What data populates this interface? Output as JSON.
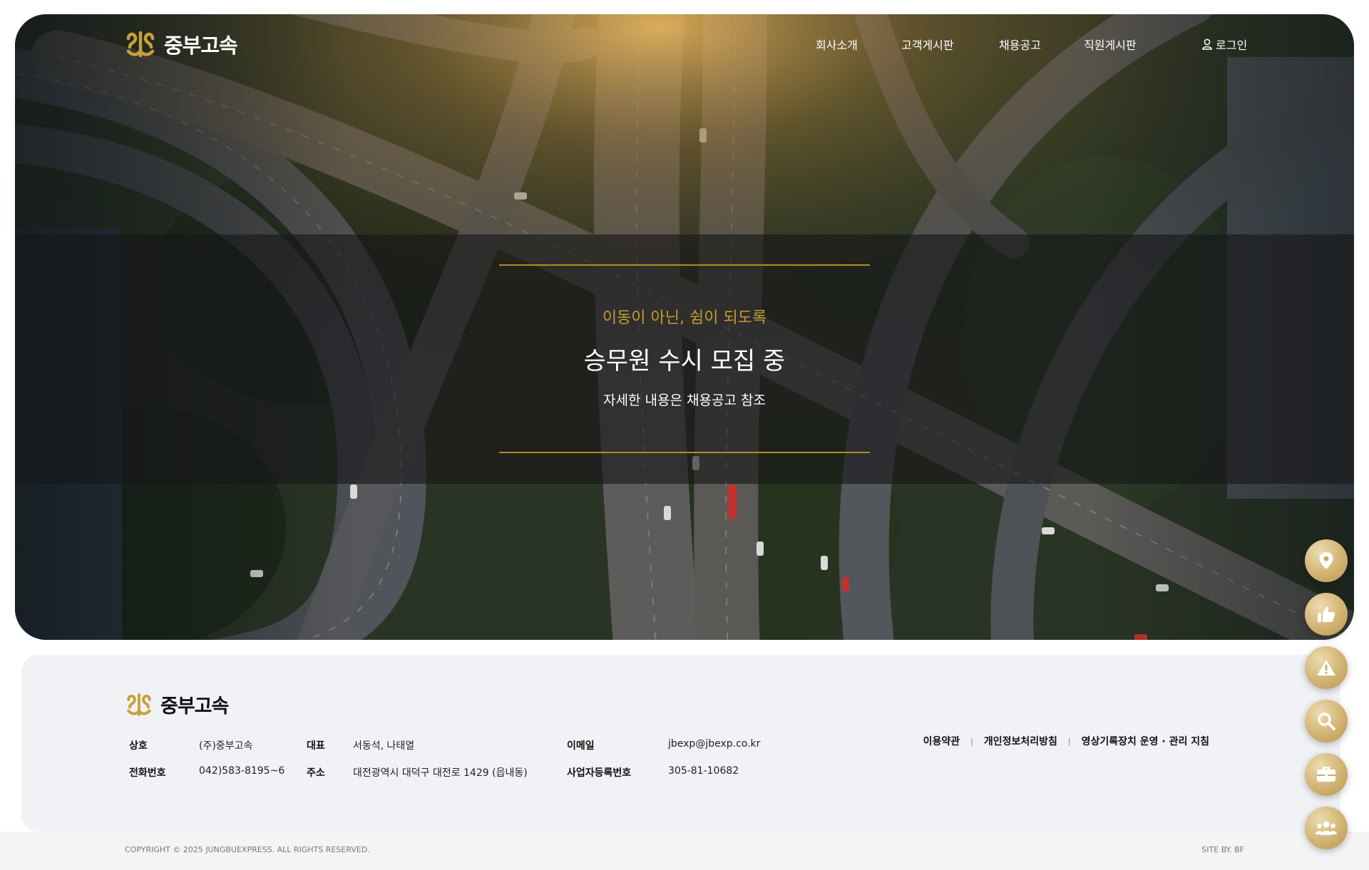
{
  "brand": {
    "name": "중부고속",
    "accent": "#b58a25",
    "logo_icon": "jungbu-emblem"
  },
  "nav": {
    "items": [
      {
        "label": "회사소개"
      },
      {
        "label": "고객게시판"
      },
      {
        "label": "채용공고"
      },
      {
        "label": "직원게시판"
      }
    ],
    "login_label": "로그인",
    "login_icon": "user-icon"
  },
  "hero": {
    "subtitle": "이동이 아닌, 쉼이 되도록",
    "title": "승무원 수시 모집 중",
    "description": "자세한 내용은 채용공고 참조"
  },
  "footer": {
    "info": {
      "company_label": "상호",
      "company": "(주)중부고속",
      "ceo_label": "대표",
      "ceo": "서동석, 나태열",
      "email_label": "이메일",
      "email": "jbexp@jbexp.co.kr",
      "phone_label": "전화번호",
      "phone": "042)583-8195~6",
      "address_label": "주소",
      "address": "대전광역시 대덕구 대전로 1429 (읍내동)",
      "bizno_label": "사업자등록번호",
      "bizno": "305-81-10682"
    },
    "links": [
      {
        "label": "이용약관"
      },
      {
        "label": "개인정보처리방침"
      },
      {
        "label": "영상기록장치 운영 · 관리 지침"
      }
    ],
    "link_separator": "|",
    "copyright": "COPYRIGHT © 2025 JUNGBUEXPRESS. ALL RIGHTS RESERVED.",
    "site_by": "SITE BY. BF"
  },
  "quick_menu": [
    {
      "icon": "location-pin-icon"
    },
    {
      "icon": "thumbs-up-icon"
    },
    {
      "icon": "warning-icon"
    },
    {
      "icon": "search-icon"
    },
    {
      "icon": "briefcase-icon"
    },
    {
      "icon": "users-icon"
    }
  ]
}
